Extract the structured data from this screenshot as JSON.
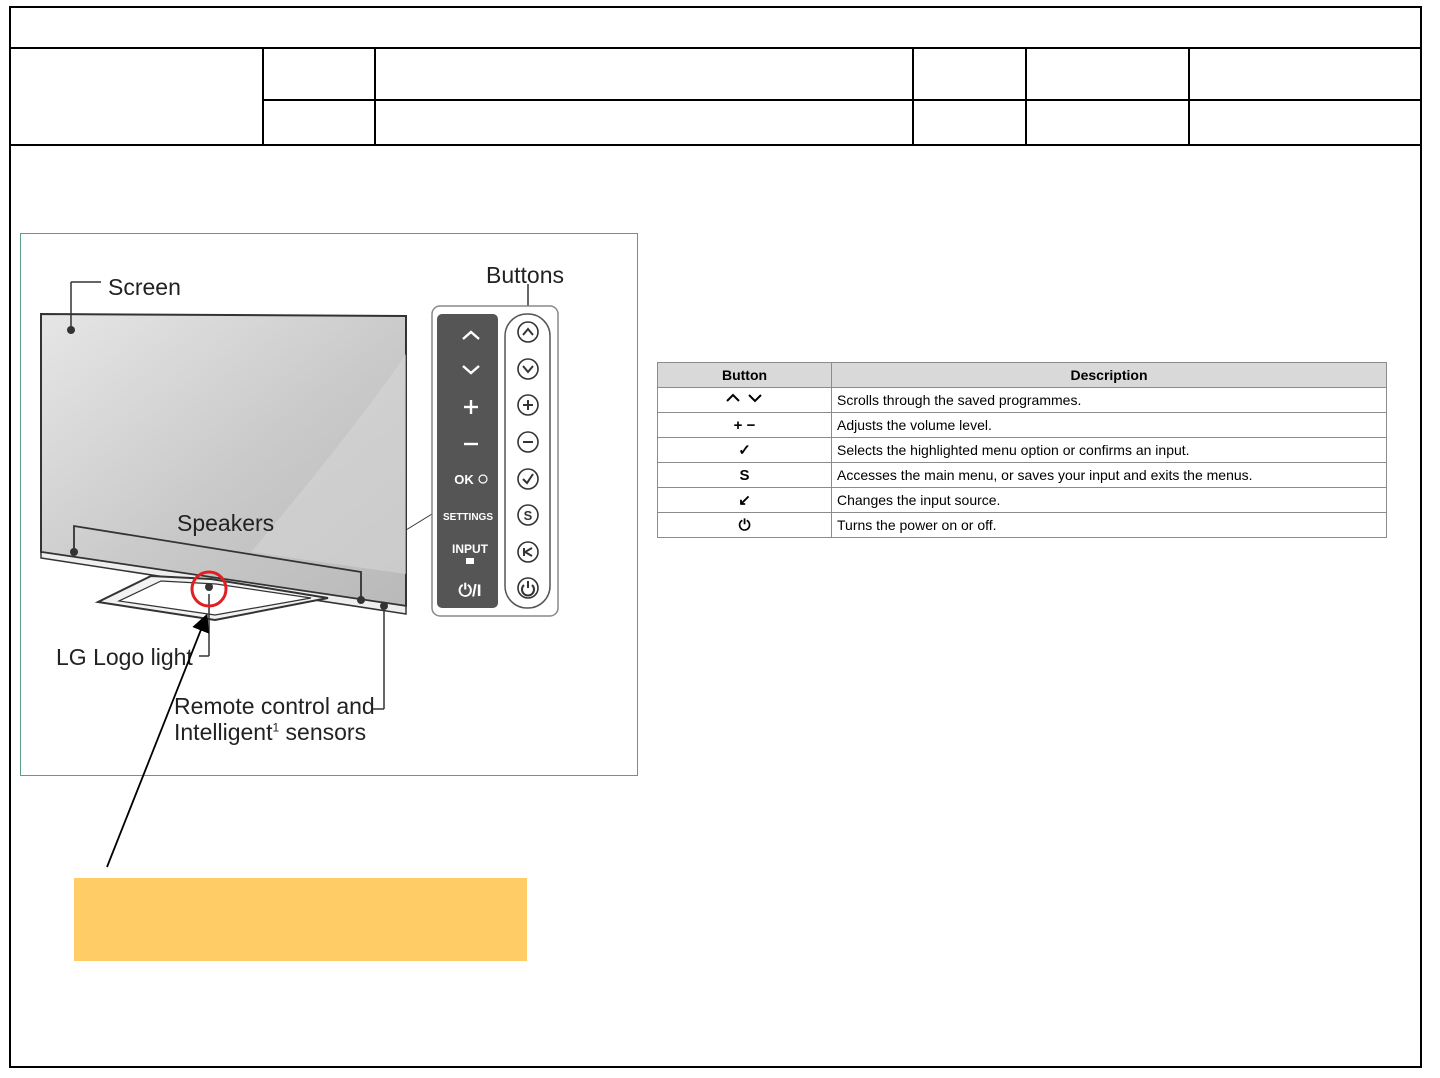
{
  "diagram": {
    "labels": {
      "screen": "Screen",
      "buttons": "Buttons",
      "speakers": "Speakers",
      "logo_light": "LG Logo light",
      "sensors_line1": "Remote control and",
      "sensors_line2_pre": "Intelligent",
      "sensors_sup": "1",
      "sensors_line2_post": " sensors"
    },
    "panel_keys": [
      "^",
      "v",
      "+",
      "−",
      "OK",
      "SETTINGS",
      "INPUT",
      "⏻/I"
    ]
  },
  "table": {
    "headers": [
      "Button",
      "Description"
    ],
    "rows": [
      {
        "symbol": "⌃ ⌄",
        "icon": "up-down-arrows-icon",
        "description": "Scrolls through the saved programmes."
      },
      {
        "symbol": "+ −",
        "icon": "plus-minus-icon",
        "description": "Adjusts the volume level."
      },
      {
        "symbol": "✓",
        "icon": "check-icon",
        "description": "Selects the highlighted menu option or confirms an input."
      },
      {
        "symbol": "S",
        "icon": "settings-s-icon",
        "description": "Accesses the main menu, or saves your input and exits the menus."
      },
      {
        "symbol": "↙",
        "icon": "input-arrow-icon",
        "description": "Changes the input source."
      },
      {
        "symbol": "⏻",
        "icon": "power-icon",
        "description": "Turns the power on or off."
      }
    ]
  },
  "colors": {
    "callout_fill": "#ffcc66",
    "highlight_circle": "#e02020",
    "diagram_border": "#5a9e86",
    "table_header_fill": "#d9d9d9"
  }
}
